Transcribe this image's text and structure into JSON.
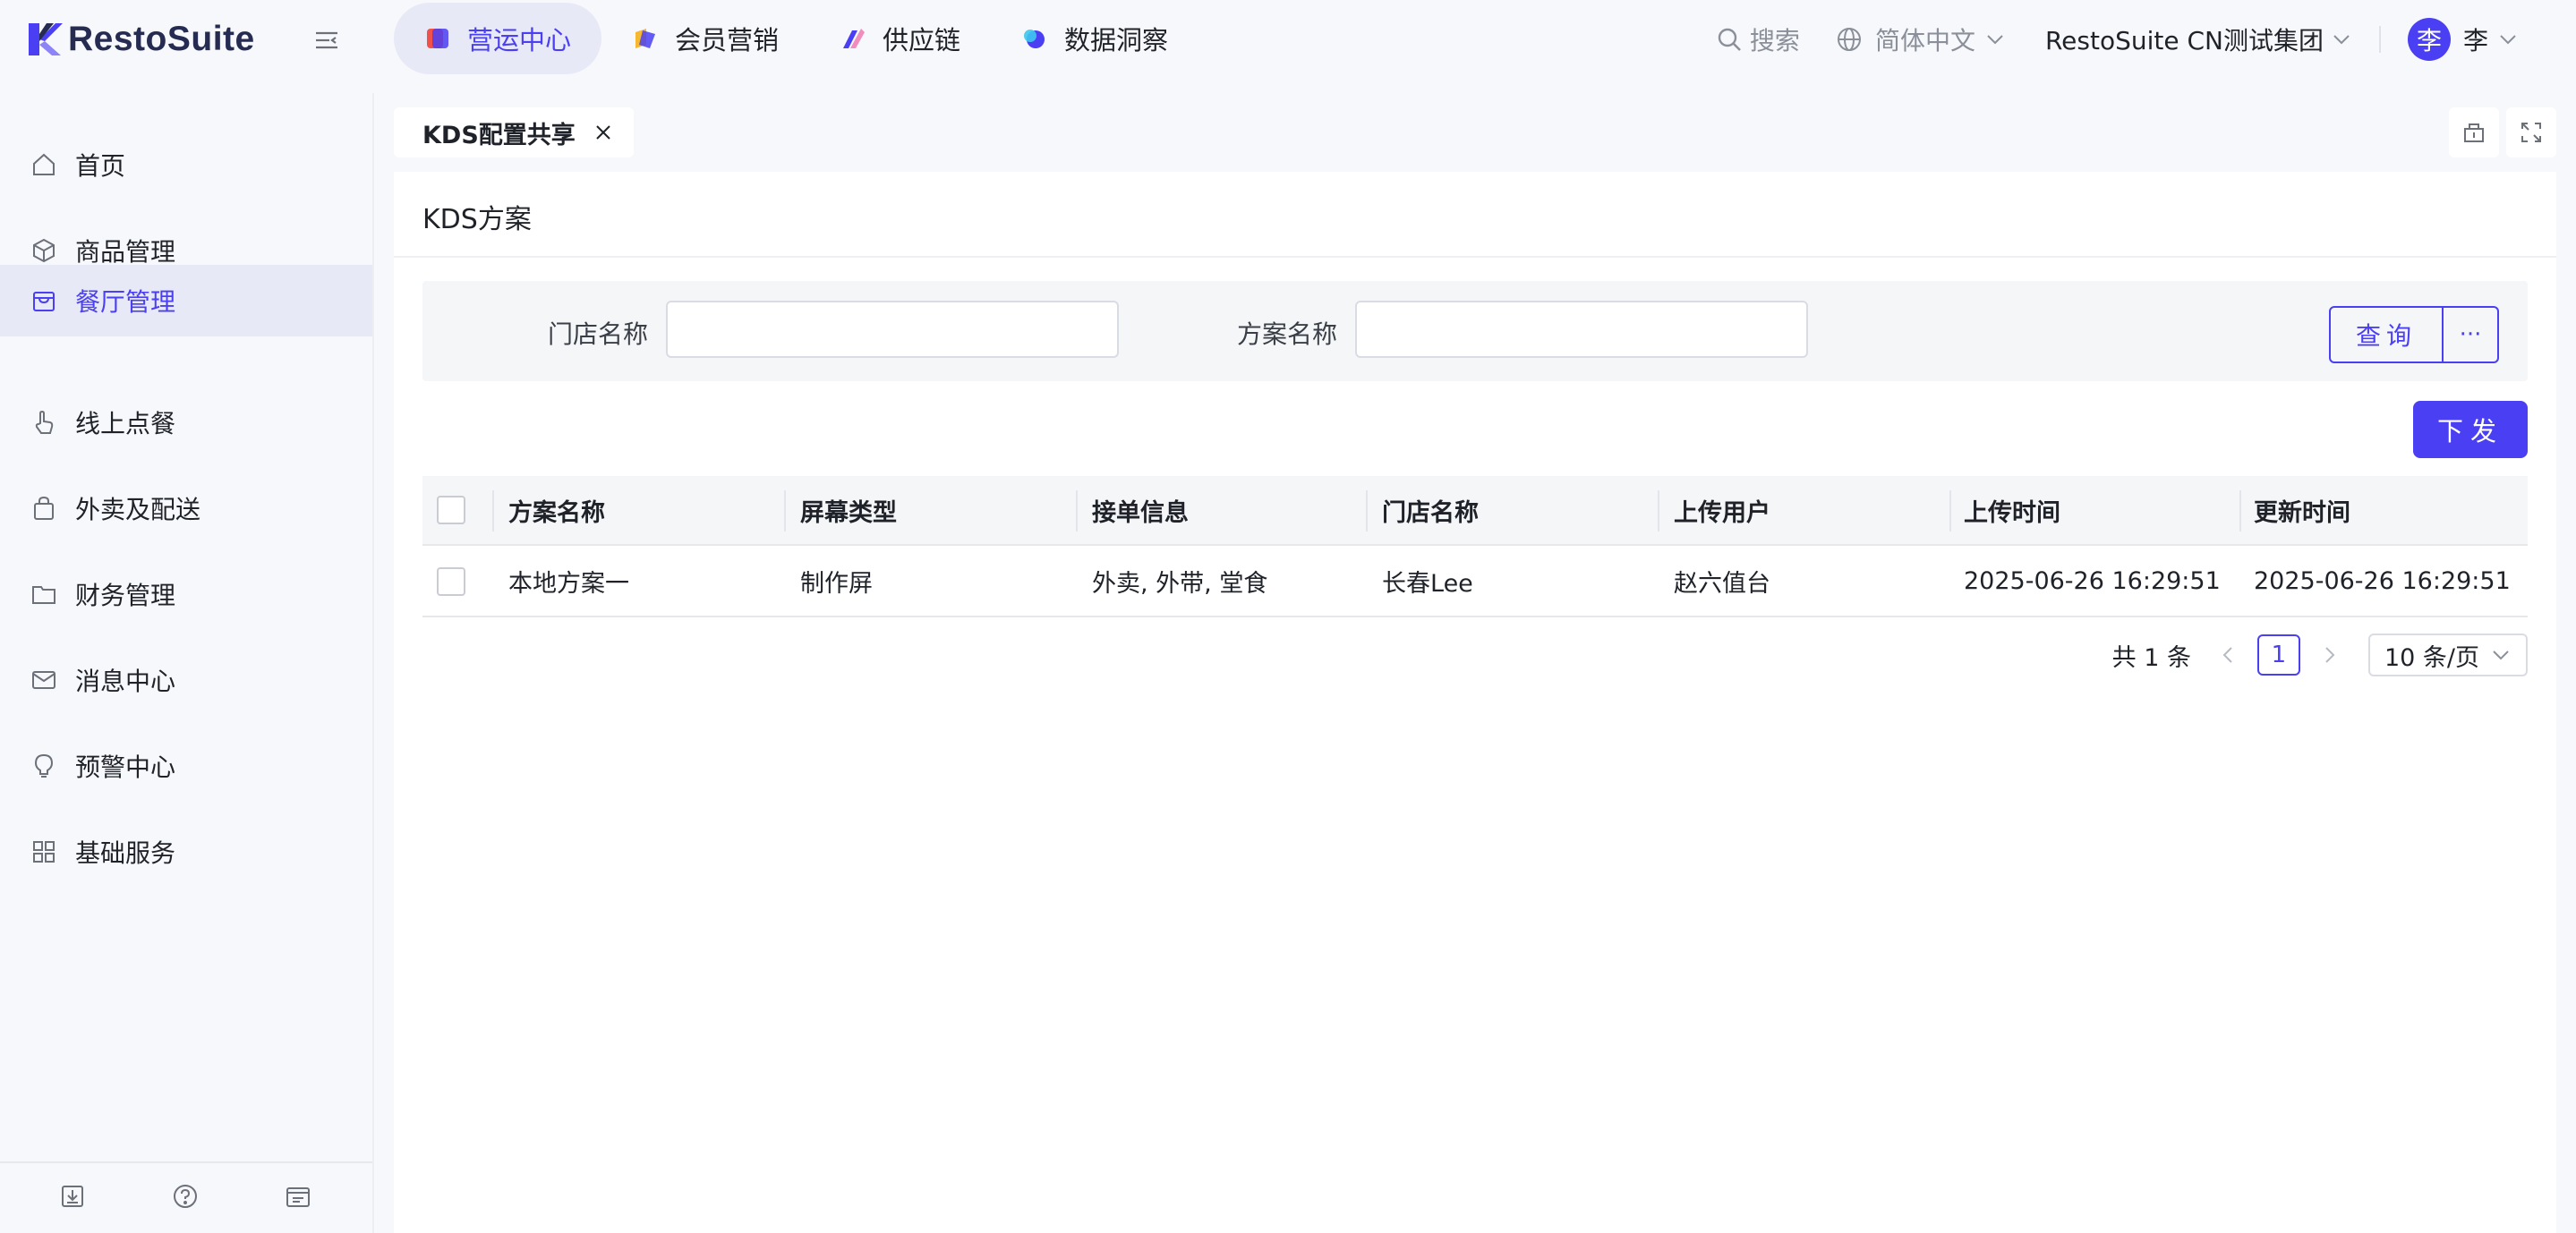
{
  "colors": {
    "accent": "#4a3ff2",
    "active_bg": "#e8e9f6",
    "text": "#1f2329",
    "muted": "#8a8f99"
  },
  "header": {
    "logo": "RestoSuite",
    "nav": [
      {
        "label": "营运中心",
        "icon": "operations-icon",
        "active": true
      },
      {
        "label": "会员营销",
        "icon": "member-marketing-icon",
        "active": false
      },
      {
        "label": "供应链",
        "icon": "supply-chain-icon",
        "active": false
      },
      {
        "label": "数据洞察",
        "icon": "data-insight-icon",
        "active": false
      }
    ],
    "search_label": "搜索",
    "language": "简体中文",
    "group": "RestoSuite CN测试集团",
    "avatar_char": "李",
    "user_name": "李"
  },
  "sidebar": {
    "items": [
      {
        "label": "首页",
        "icon": "home-icon"
      },
      {
        "label": "商品管理",
        "icon": "cube-icon"
      },
      {
        "label": "餐厅管理",
        "icon": "store-icon",
        "active": true
      },
      {
        "label": "线上点餐",
        "icon": "hand-pointer-icon"
      },
      {
        "label": "外卖及配送",
        "icon": "bag-icon"
      },
      {
        "label": "财务管理",
        "icon": "folder-icon"
      },
      {
        "label": "消息中心",
        "icon": "mail-icon"
      },
      {
        "label": "预警中心",
        "icon": "bulb-icon"
      },
      {
        "label": "基础服务",
        "icon": "grid-icon"
      }
    ],
    "bottom_icons": [
      "download-icon",
      "help-icon",
      "terminal-icon"
    ]
  },
  "tabs": [
    {
      "label": "KDS配置共享"
    }
  ],
  "panel": {
    "title": "KDS方案",
    "filters": {
      "store_label": "门店名称",
      "store_value": "",
      "plan_label": "方案名称",
      "plan_value": ""
    },
    "query_label": "查询",
    "more_label": "···",
    "issue_label": "下发",
    "table": {
      "columns": [
        "方案名称",
        "屏幕类型",
        "接单信息",
        "门店名称",
        "上传用户",
        "上传时间",
        "更新时间"
      ],
      "rows": [
        [
          "本地方案一",
          "制作屏",
          "外卖, 外带, 堂食",
          "长春Lee",
          "赵六值台",
          "2025-06-26 16:29:51",
          "2025-06-26 16:29:51"
        ]
      ]
    },
    "pagination": {
      "total_text": "共 1 条",
      "current_page": "1",
      "page_size": "10 条/页"
    }
  }
}
